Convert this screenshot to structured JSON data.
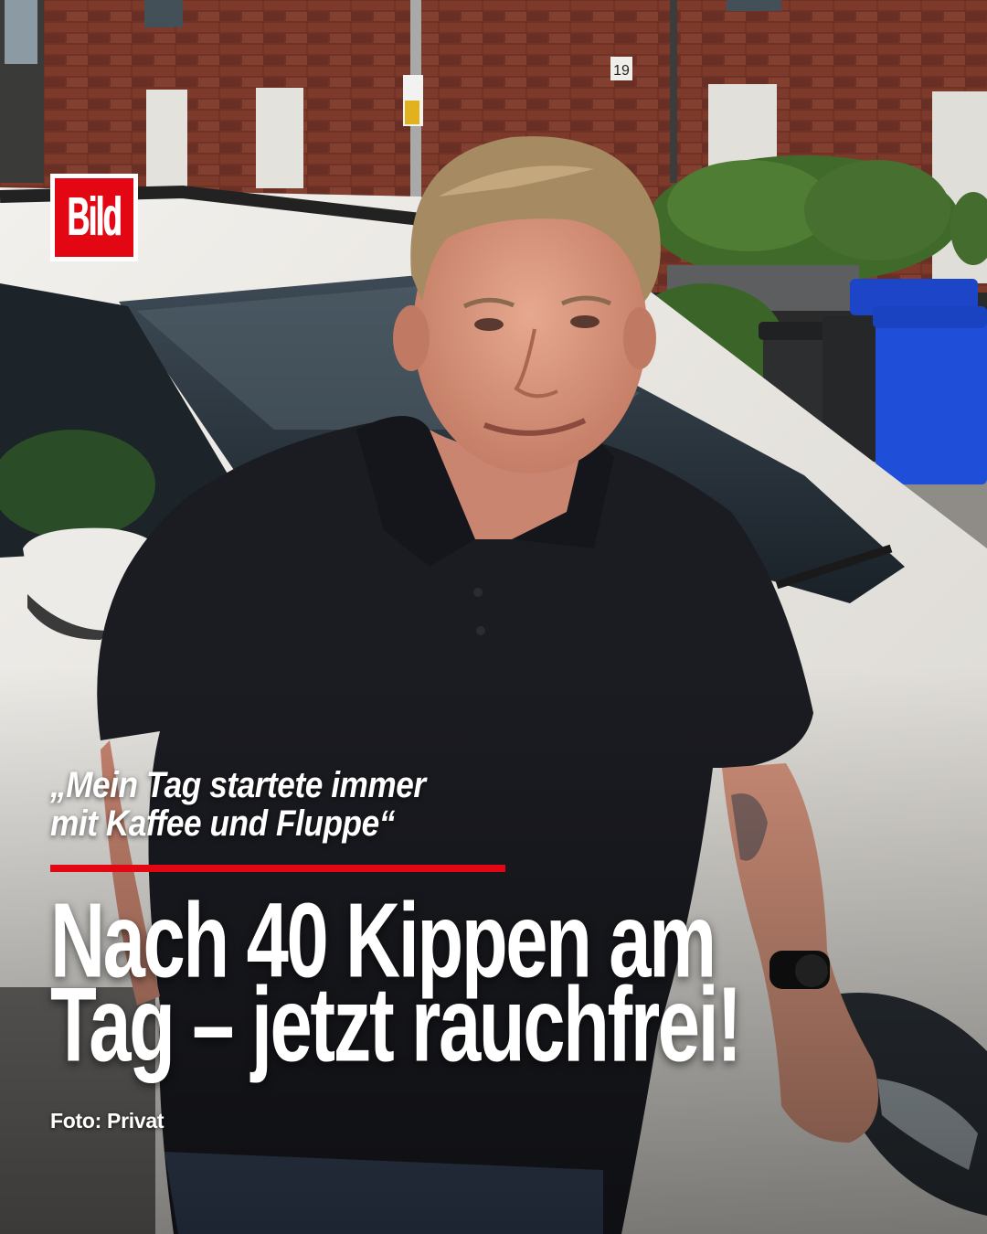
{
  "brand": {
    "logo_text": "Bild"
  },
  "quote": {
    "line1": "„Mein Tag startete immer",
    "line2": "mit Kaffee und Fluppe“"
  },
  "headline": {
    "line1": "Nach 40 Kippen am",
    "line2": "Tag – jetzt rauchfrei!"
  },
  "credit": "Foto: Privat",
  "house_number": "19",
  "colors": {
    "brand_red": "#e30613",
    "brick": "#7a3a2c",
    "shirt": "#1b1c22",
    "car": "#e9e7e2",
    "bin_blue": "#1f4fd8"
  }
}
